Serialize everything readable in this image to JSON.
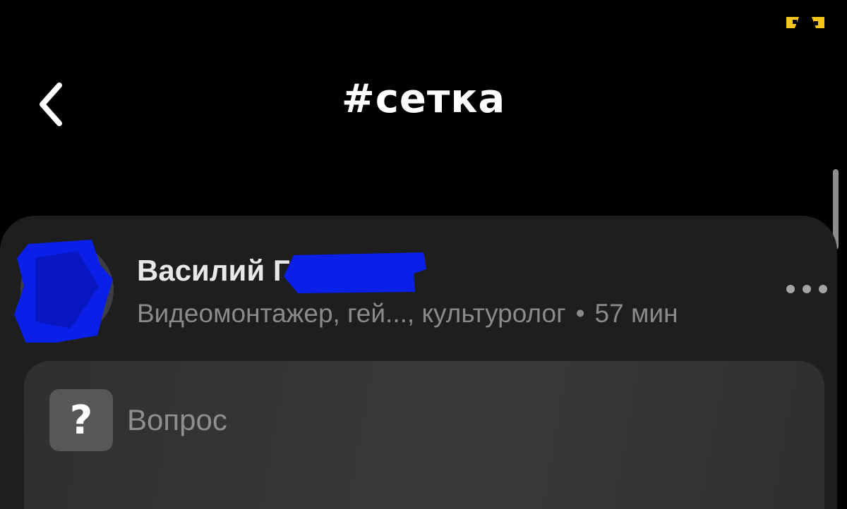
{
  "header": {
    "title": "#сетка",
    "back_icon": "chevron-left-icon"
  },
  "status": {
    "indicator_icon": "yellow-brackets-icon",
    "indicator_color": "#f5c518"
  },
  "post": {
    "author": {
      "name_visible": "Василий Г",
      "avatar_icon": "avatar-redacted",
      "redaction_color": "#0a1fe8"
    },
    "meta": {
      "occupation": "Видеомонтажер, гей..., культуролог",
      "separator": "•",
      "time": "57 мин"
    },
    "more_icon": "more-horizontal-icon",
    "question": {
      "icon_glyph": "?",
      "label": "Вопрос"
    }
  }
}
